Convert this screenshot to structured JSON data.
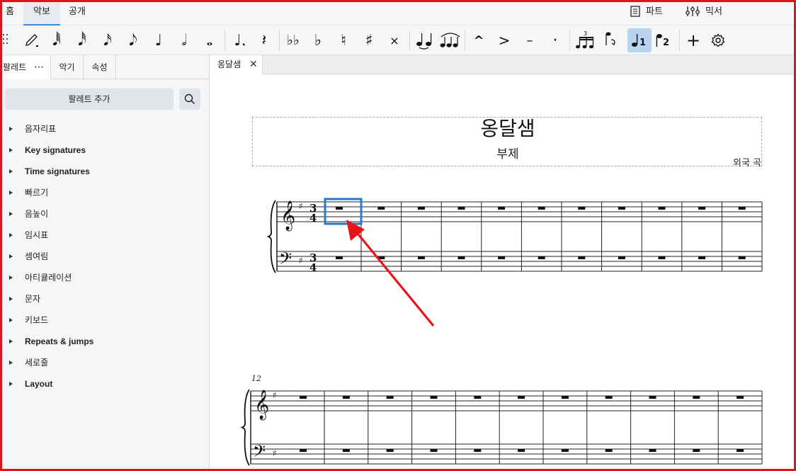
{
  "menu": {
    "tabs": [
      "홈",
      "악보",
      "공개"
    ],
    "parts_label": "파트",
    "mixer_label": "믹서"
  },
  "toolbar": {
    "note_input_icon": "pencil-icon",
    "durations": [
      "𝅘𝅥𝅱",
      "𝅘𝅥𝅰",
      "𝅘𝅥𝅯",
      "𝅘𝅥𝅮",
      "♩",
      "𝅗𝅥",
      "𝅝"
    ],
    "dot": "♩.",
    "rest": "𝄽",
    "accidentals": [
      "♭♭",
      "♭",
      "♮",
      "♯",
      "×"
    ],
    "ties": [
      "tie-icon",
      "slur-icon"
    ],
    "articulations": [
      "^",
      ">",
      "–",
      "·"
    ],
    "tuplet": "tuplet-icon",
    "flip": "flip-direction-icon",
    "voice1": "1",
    "voice2": "2",
    "add": "+",
    "settings": "gear-icon"
  },
  "panel": {
    "tabs": [
      "팔레트",
      "악기",
      "속성"
    ],
    "more_label": "⋯",
    "add_palette_label": "팔레트 추가",
    "items": [
      {
        "label": "음자리표",
        "bold": false
      },
      {
        "label": "Key signatures",
        "bold": true
      },
      {
        "label": "Time signatures",
        "bold": true
      },
      {
        "label": "빠르기",
        "bold": false
      },
      {
        "label": "음높이",
        "bold": false
      },
      {
        "label": "임시표",
        "bold": false
      },
      {
        "label": "셈여림",
        "bold": false
      },
      {
        "label": "아티큘레이션",
        "bold": false
      },
      {
        "label": "문자",
        "bold": false
      },
      {
        "label": "키보드",
        "bold": false
      },
      {
        "label": "Repeats & jumps",
        "bold": true
      },
      {
        "label": "세로줄",
        "bold": false
      },
      {
        "label": "Layout",
        "bold": true
      }
    ]
  },
  "score": {
    "tab_title": "옹달샘",
    "tab_close": "✕",
    "title": "옹달샘",
    "subtitle": "부제",
    "composer": "외국 곡",
    "time_signature": {
      "numerator": "3",
      "denominator": "4"
    },
    "key_signature": "♯",
    "system2_measure_number": "12",
    "system1_measure_count": 11,
    "system2_measure_count": 11,
    "selected_measure": 1
  },
  "colors": {
    "frame": "#e0141e",
    "selection": "#2a78c6",
    "arrow": "#e8141b",
    "active_tab": "#3a8ad6"
  }
}
